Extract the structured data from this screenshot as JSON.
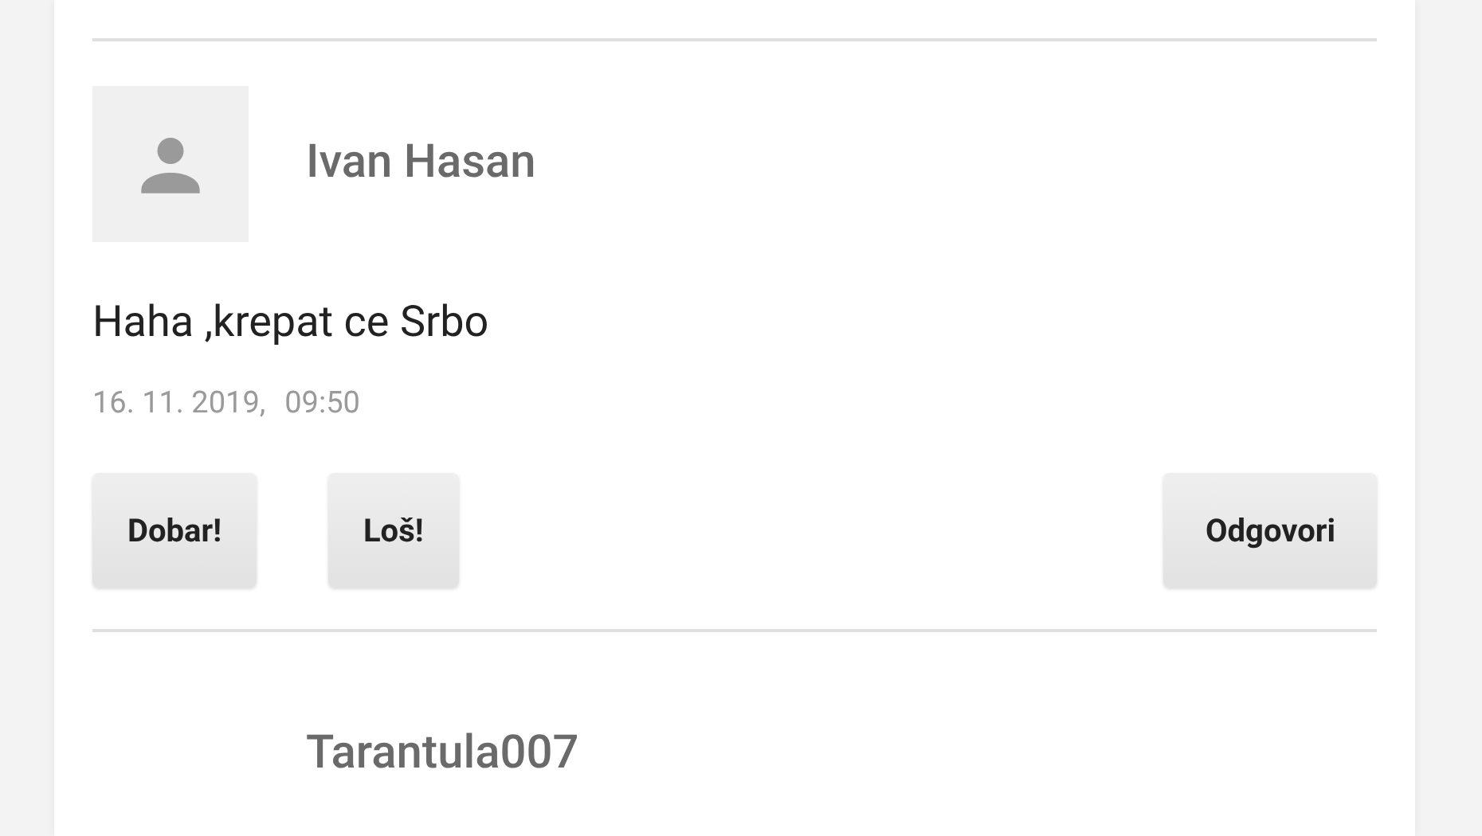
{
  "comments": [
    {
      "author": "Ivan Hasan",
      "avatar": true,
      "text": "Haha ,krepat ce Srbo",
      "date": "16. 11. 2019,",
      "time": "09:50",
      "buttons": [
        {
          "label": "Dobar!",
          "kind": "vote"
        },
        {
          "label": "Loš!",
          "kind": "vote"
        },
        {
          "label": "Odgovori",
          "kind": "reply"
        }
      ]
    },
    {
      "author": "Tarantula007"
    }
  ]
}
